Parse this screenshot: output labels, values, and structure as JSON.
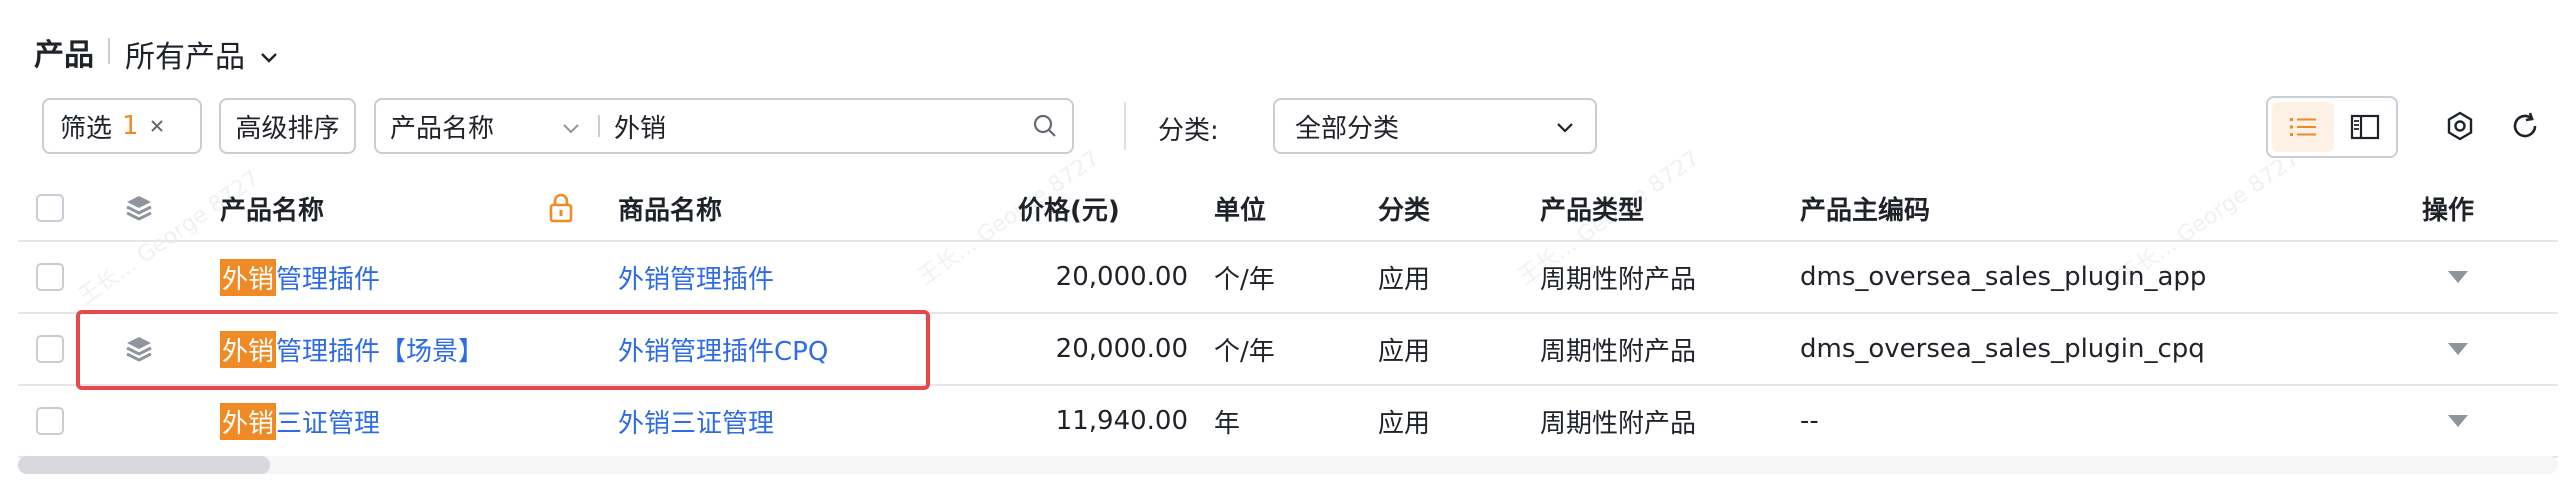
{
  "header": {
    "title": "产品",
    "view_label": "所有产品"
  },
  "toolbar": {
    "filter_label": "筛选",
    "filter_count": "1",
    "sort_label": "高级排序",
    "search_field": "产品名称",
    "search_value": "外销",
    "category_label": "分类:",
    "category_value": "全部分类"
  },
  "table": {
    "columns": {
      "product_name": "产品名称",
      "goods_name": "商品名称",
      "price": "价格(元)",
      "unit": "单位",
      "category": "分类",
      "product_type": "产品类型",
      "master_code": "产品主编码",
      "actions": "操作"
    },
    "rows": [
      {
        "name_hl": "外销",
        "name_rest": "管理插件",
        "goods": "外销管理插件",
        "price": "20,000.00",
        "unit": "个/年",
        "category": "应用",
        "type": "周期性附产品",
        "code": "dms_oversea_sales_plugin_app",
        "has_bundle_icon": false
      },
      {
        "name_hl": "外销",
        "name_rest": "管理插件【场景】",
        "goods": "外销管理插件CPQ",
        "price": "20,000.00",
        "unit": "个/年",
        "category": "应用",
        "type": "周期性附产品",
        "code": "dms_oversea_sales_plugin_cpq",
        "has_bundle_icon": true
      },
      {
        "name_hl": "外销",
        "name_rest": "三证管理",
        "goods": "外销三证管理",
        "price": "11,940.00",
        "unit": "年",
        "category": "应用",
        "type": "周期性附产品",
        "code": "--",
        "has_bundle_icon": false
      }
    ]
  },
  "colors": {
    "accent": "#f08a24",
    "link": "#2e6be6",
    "highlight_box": "#e5484d"
  },
  "icons": [
    "chevron-down-icon",
    "close-icon",
    "search-icon",
    "list-view-icon",
    "card-view-icon",
    "settings-icon",
    "refresh-icon",
    "bundle-icon",
    "lock-icon",
    "row-actions-icon"
  ]
}
